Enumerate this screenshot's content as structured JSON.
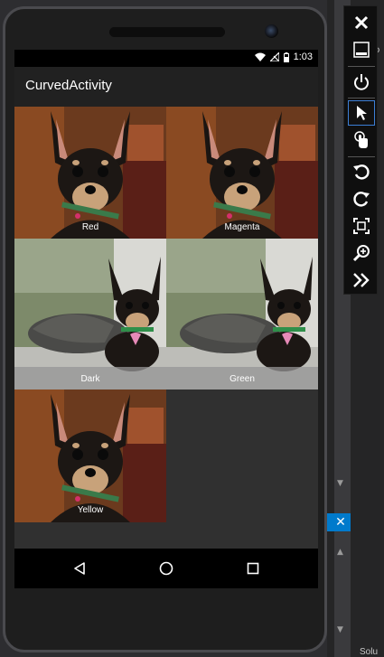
{
  "device": {
    "status_time": "1:03",
    "app_title": "CurvedActivity"
  },
  "tiles": [
    {
      "label": "Red",
      "photo": "chihuahua-portrait"
    },
    {
      "label": "Magenta",
      "photo": "chihuahua-portrait"
    },
    {
      "label": "Dark",
      "photo": "chihuahua-with-cat"
    },
    {
      "label": "Green",
      "photo": "chihuahua-with-cat"
    },
    {
      "label": "Yellow",
      "photo": "chihuahua-portrait"
    }
  ],
  "emulator_toolbar": {
    "icons": [
      "close-icon",
      "minimize-icon",
      "power-icon",
      "pointer-icon",
      "touch-icon",
      "rotate-left-icon",
      "rotate-right-icon",
      "screenshot-icon",
      "zoom-icon",
      "more-icon"
    ]
  },
  "ide": {
    "panel_label": "Solu"
  },
  "colors": {
    "appbar": "#212121",
    "screen_bg": "#303030",
    "ide_accent": "#007acc"
  }
}
